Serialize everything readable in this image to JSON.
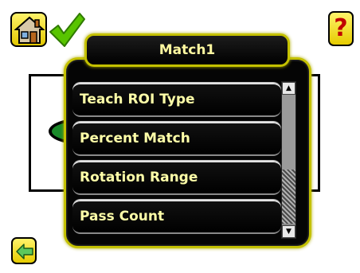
{
  "header": {
    "home_icon": "home-icon",
    "status_icon": "checkmark-icon",
    "help_label": "?"
  },
  "menu": {
    "title": "Match1",
    "items": [
      {
        "label": "Teach ROI Type"
      },
      {
        "label": "Percent Match"
      },
      {
        "label": "Rotation Range"
      },
      {
        "label": "Pass Count"
      }
    ]
  },
  "footer": {
    "back_icon": "back-arrow-icon"
  },
  "colors": {
    "accent": "#c4c100",
    "button_bg": "#f2dc00",
    "menu_text": "#ffffa8",
    "status_green": "#58c400",
    "help_red": "#c00000"
  }
}
